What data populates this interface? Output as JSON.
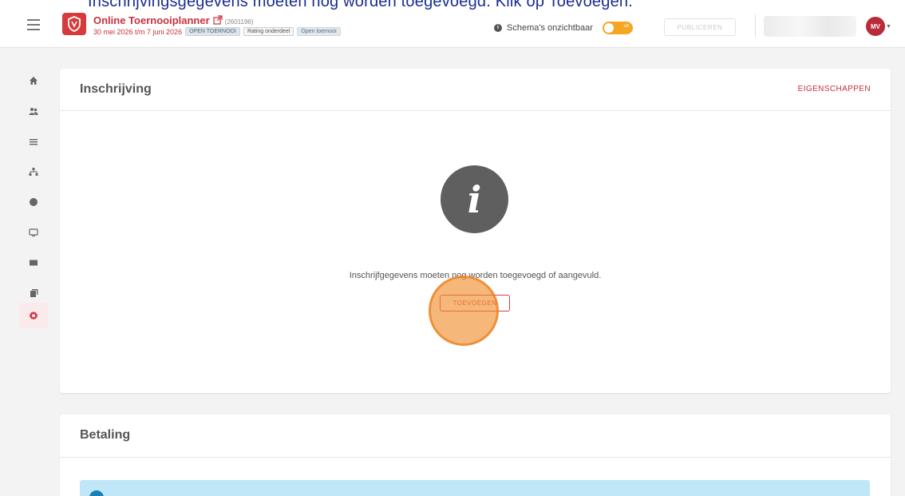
{
  "caption": {
    "text": "Inschrijvingsgegevens moeten nog worden toegevoegd. Klik op Toevoegen."
  },
  "header": {
    "title": "Online Toernooiplanner",
    "id": "(2601196)",
    "date_range": "30 mei 2026 t/m 7 juni 2026",
    "chips": [
      "OPEN TOERNOOI",
      "Rating onderdeel",
      "Open toernooi"
    ],
    "visibility_label": "Schema's onzichtbaar",
    "toggle_text": "uit",
    "publish_label": "PUBLICEREN",
    "avatar_initials": "MV"
  },
  "sidebar": {
    "items": [
      {
        "icon": "home-icon"
      },
      {
        "icon": "users-icon"
      },
      {
        "icon": "list-icon"
      },
      {
        "icon": "tree-icon"
      },
      {
        "icon": "globe-icon"
      },
      {
        "icon": "monitor-icon"
      },
      {
        "icon": "mail-icon"
      },
      {
        "icon": "documents-icon"
      },
      {
        "icon": "gear-icon",
        "active": true
      }
    ]
  },
  "inschrijving": {
    "title": "Inschrijving",
    "action": "EIGENSCHAPPEN",
    "message": "Inschrijfgegevens moeten nog worden toegevoegd of aangevuld.",
    "button": "TOEVOEGEN"
  },
  "betaling": {
    "title": "Betaling"
  },
  "colors": {
    "brand": "#c8303c",
    "toggle": "#f5a623",
    "notice": "#bfe7f7"
  }
}
